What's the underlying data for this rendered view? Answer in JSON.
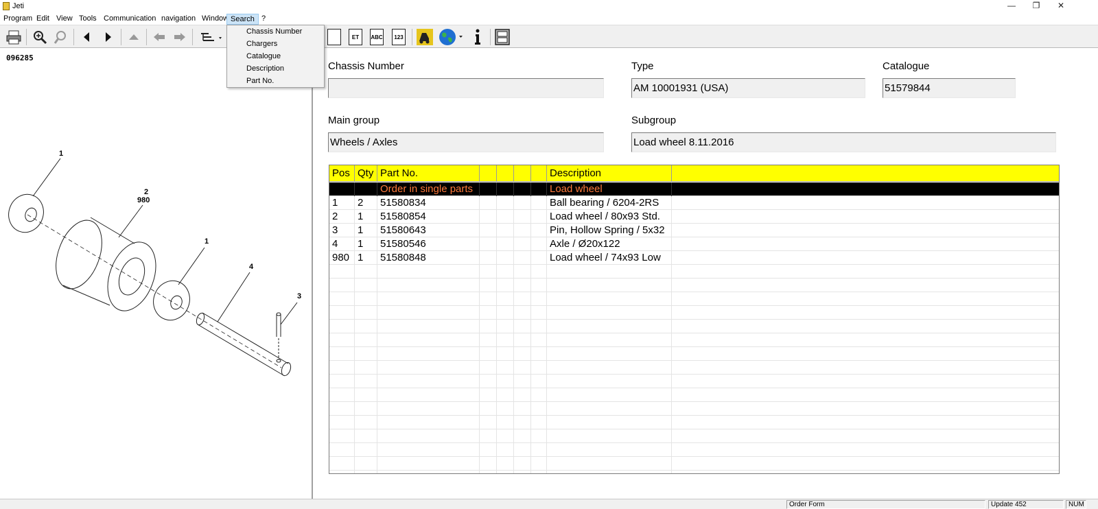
{
  "window": {
    "title": "Jeti",
    "minimize": "—",
    "restore": "❐",
    "close": "✕"
  },
  "menu": {
    "items": [
      {
        "label": "Program"
      },
      {
        "label": "Edit"
      },
      {
        "label": "View"
      },
      {
        "label": "Tools"
      },
      {
        "label": "Communication"
      },
      {
        "label": "navigation"
      },
      {
        "label": "Window"
      },
      {
        "label": "Search"
      },
      {
        "label": "?"
      }
    ],
    "search_dropdown": [
      "Chassis Number",
      "Chargers",
      "Catalogue",
      "Description",
      "Part No."
    ]
  },
  "toolbar": {
    "doc_icons": [
      "ET",
      "ABC",
      "123"
    ]
  },
  "drawing": {
    "number": "096285",
    "callouts": [
      "1",
      "2",
      "980",
      "1",
      "4",
      "3"
    ]
  },
  "header": {
    "chassis_label": "Chassis Number",
    "chassis_value": "",
    "type_label": "Type",
    "type_value": "AM 10001931 (USA)",
    "catalogue_label": "Catalogue",
    "catalogue_value": "51579844",
    "main_group_label": "Main group",
    "main_group_value": "Wheels / Axles",
    "subgroup_label": "Subgroup",
    "subgroup_value": "Load wheel 8.11.2016"
  },
  "table": {
    "columns": [
      "Pos",
      "Qty",
      "Part No.",
      "",
      "",
      "",
      "",
      "Description",
      ""
    ],
    "highlight_row": {
      "part": "Order in single parts",
      "description": "Load wheel"
    },
    "rows": [
      {
        "pos": "1",
        "qty": "2",
        "part": "51580834",
        "description": "Ball bearing / 6204-2RS"
      },
      {
        "pos": "2",
        "qty": "1",
        "part": "51580854",
        "description": "Load wheel / 80x93 Std."
      },
      {
        "pos": "3",
        "qty": "1",
        "part": "51580643",
        "description": "Pin, Hollow Spring / 5x32"
      },
      {
        "pos": "4",
        "qty": "1",
        "part": "51580546",
        "description": "Axle / Ø20x122"
      },
      {
        "pos": "980",
        "qty": "1",
        "part": "51580848",
        "description": "Load wheel / 74x93 Low"
      }
    ]
  },
  "status": {
    "order_form": "Order Form",
    "update": "Update 452",
    "num": "NUM"
  },
  "colors": {
    "header_bg": "#ffff00",
    "highlight_row_bg": "#000000",
    "highlight_text": "#ff7a3c"
  }
}
